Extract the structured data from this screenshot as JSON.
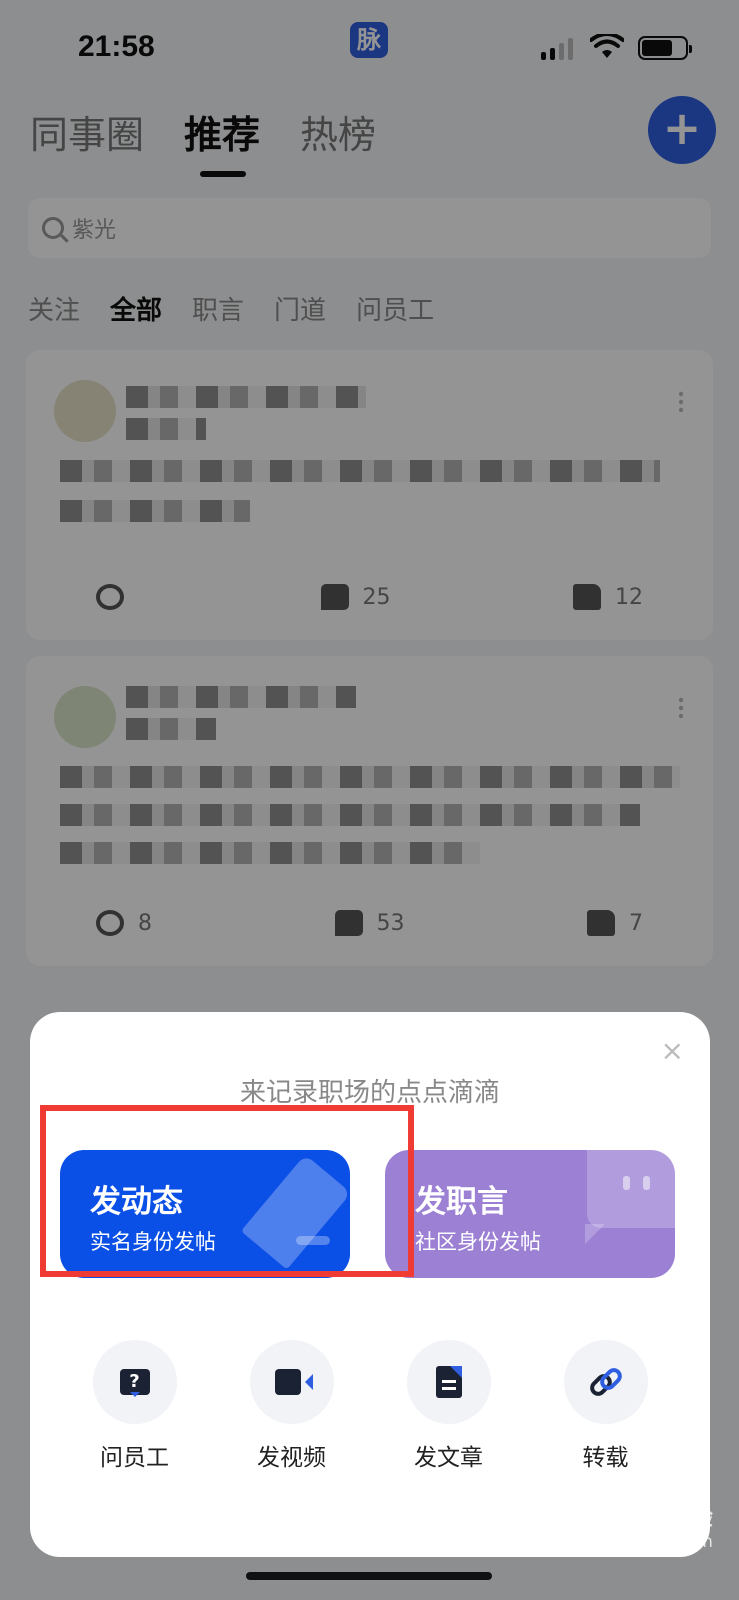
{
  "status_bar": {
    "time": "21:58",
    "app_badge": "脉"
  },
  "header": {
    "tabs": [
      {
        "label": "同事圈"
      },
      {
        "label": "推荐"
      },
      {
        "label": "热榜"
      }
    ],
    "plus_label": "+"
  },
  "search": {
    "placeholder": "紫光"
  },
  "filters": [
    "关注",
    "全部",
    "职言",
    "门道",
    "问员工"
  ],
  "feed": [
    {
      "share": "",
      "comments": "25",
      "likes": "12"
    },
    {
      "share": "8",
      "comments": "53",
      "likes": "7"
    }
  ],
  "sheet": {
    "close": "×",
    "title": "来记录职场的点点滴滴",
    "post_dynamic": {
      "title": "发动态",
      "subtitle": "实名身份发帖"
    },
    "post_voice": {
      "title": "发职言",
      "subtitle": "社区身份发帖"
    },
    "quick_actions": [
      {
        "label": "问员工",
        "icon": "ask-icon"
      },
      {
        "label": "发视频",
        "icon": "video-icon"
      },
      {
        "label": "发文章",
        "icon": "article-icon"
      },
      {
        "label": "转载",
        "icon": "link-icon"
      }
    ]
  },
  "colors": {
    "primary": "#0a4fe6",
    "voice": "#9c80d4",
    "highlight": "#ef3b34"
  },
  "watermark": {
    "brand": "Baidu经验",
    "url": "jingyan.baidu.com"
  }
}
